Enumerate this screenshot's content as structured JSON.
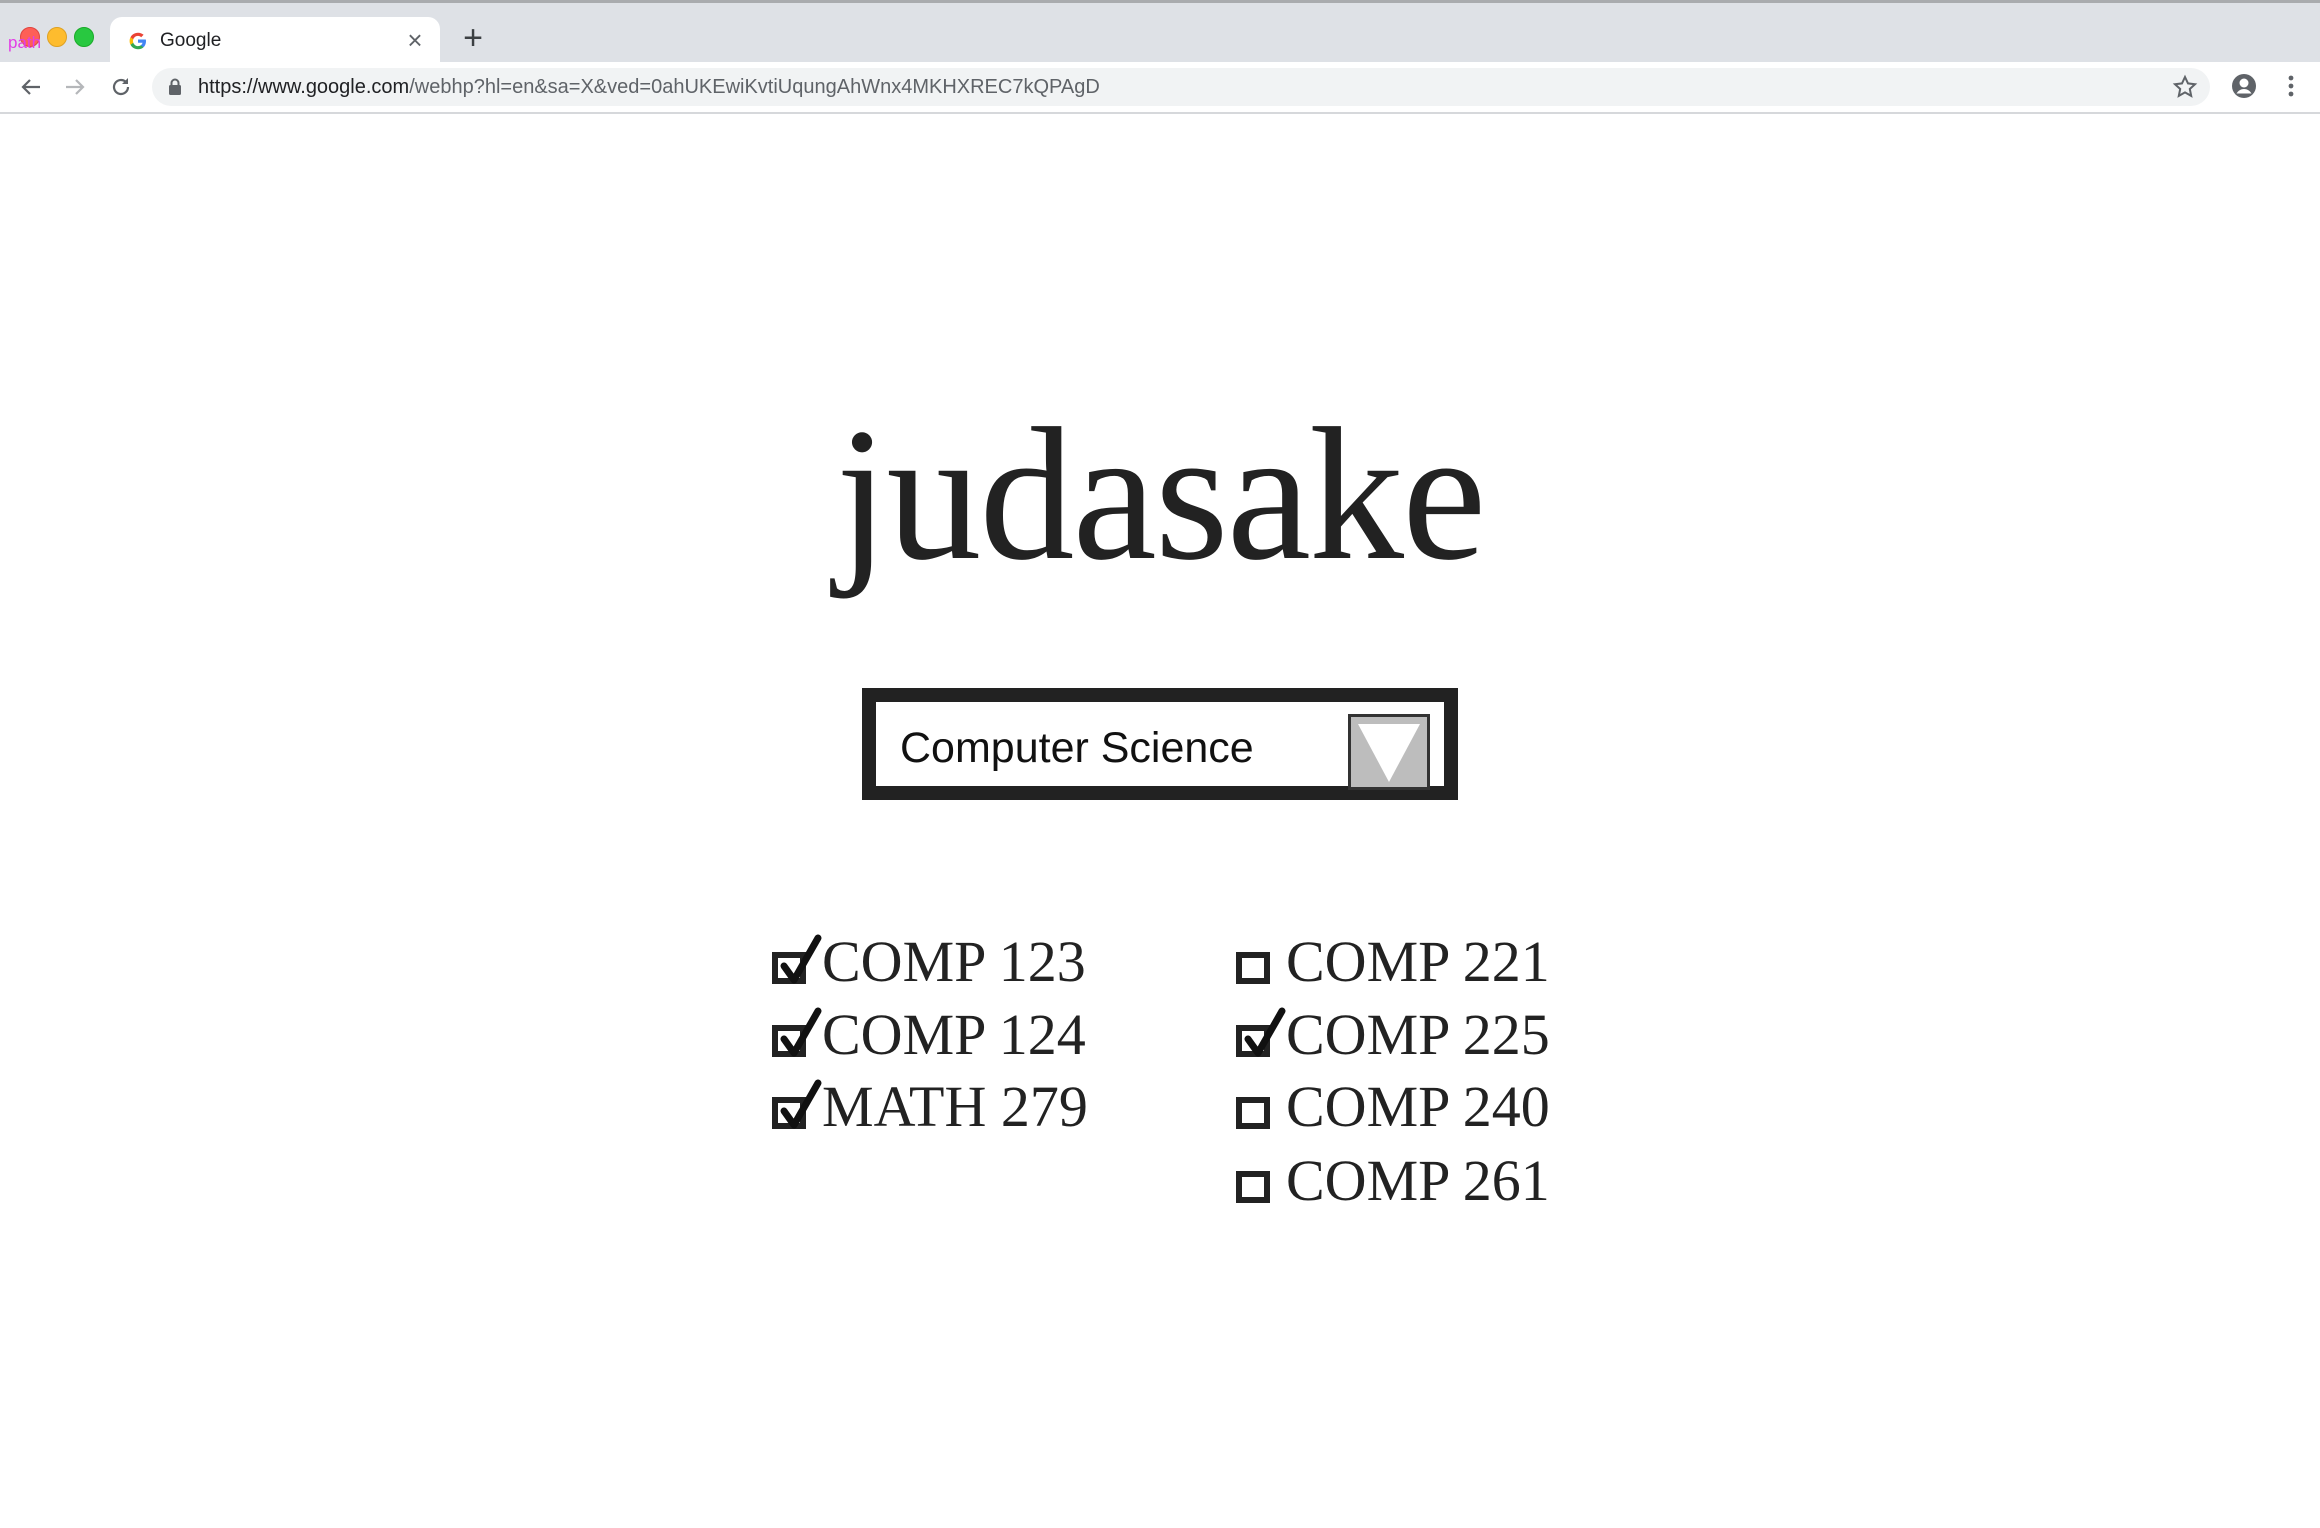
{
  "browser": {
    "tab_title": "Google",
    "url_host": "https://www.google.com",
    "url_path": "/webhp?hl=en&sa=X&ved=0ahUKEwiKvtiUqungAhWnx4MKHXREC7kQPAgD",
    "overlay_label": "path",
    "icons": [
      "close-icon",
      "plus-icon",
      "back-arrow-icon",
      "forward-arrow-icon",
      "reload-icon",
      "lock-icon",
      "star-icon",
      "profile-icon",
      "more-vert-icon"
    ]
  },
  "page": {
    "logo": "judasake",
    "department": {
      "selected": "Computer Science"
    },
    "courses_left": [
      {
        "label": "COMP 123",
        "checked": true
      },
      {
        "label": "COMP 124",
        "checked": true
      },
      {
        "label": "MATH 279",
        "checked": true
      }
    ],
    "courses_right": [
      {
        "label": "COMP 221",
        "checked": false
      },
      {
        "label": "COMP 225",
        "checked": true
      },
      {
        "label": "COMP 240",
        "checked": false
      },
      {
        "label": "COMP 261",
        "checked": false
      }
    ]
  }
}
